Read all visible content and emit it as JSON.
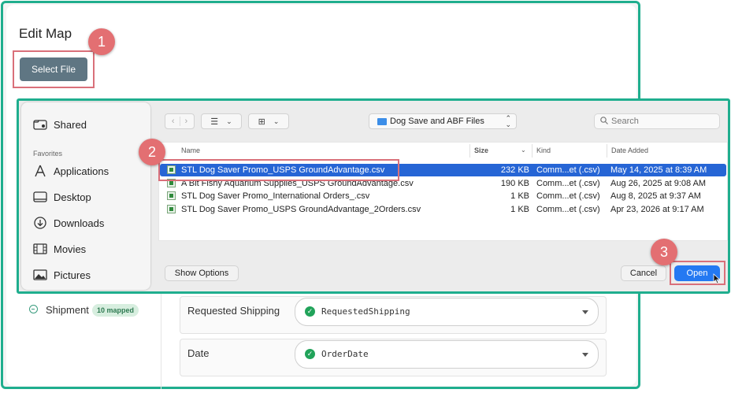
{
  "page": {
    "title": "Edit Map",
    "select_file_label": "Select File"
  },
  "steps": [
    "1",
    "2",
    "3"
  ],
  "shipment": {
    "label": "Shipment",
    "badge": "10 mapped"
  },
  "fields": [
    {
      "label": "Requested Shipping",
      "value": "RequestedShipping"
    },
    {
      "label": "Date",
      "value": "OrderDate"
    }
  ],
  "dialog": {
    "sidebar": {
      "shared": "Shared",
      "favorites_heading": "Favorites",
      "favorites": [
        "Applications",
        "Desktop",
        "Downloads",
        "Movies",
        "Pictures"
      ]
    },
    "location": "Dog Save and ABF Files",
    "search_placeholder": "Search",
    "columns": {
      "name": "Name",
      "size": "Size",
      "kind": "Kind",
      "date": "Date Added"
    },
    "files": [
      {
        "name": "STL Dog Saver Promo_USPS GroundAdvantage.csv",
        "size": "232 KB",
        "kind": "Comm...et (.csv)",
        "date": "May 14, 2025 at 8:39 AM",
        "selected": true
      },
      {
        "name": "A Bit Fishy Aquarium Supplies_USPS GroundAdvantage.csv",
        "size": "190 KB",
        "kind": "Comm...et (.csv)",
        "date": "Aug 26, 2025 at 9:08 AM",
        "selected": false
      },
      {
        "name": "STL Dog Saver Promo_International Orders_.csv",
        "size": "1 KB",
        "kind": "Comm...et (.csv)",
        "date": "Aug 8, 2025 at 9:37 AM",
        "selected": false
      },
      {
        "name": "STL Dog Saver Promo_USPS GroundAdvantage_2Orders.csv",
        "size": "1 KB",
        "kind": "Comm...et (.csv)",
        "date": "Apr 23, 2026 at 9:17 AM",
        "selected": false
      }
    ],
    "show_options": "Show Options",
    "cancel": "Cancel",
    "open": "Open"
  },
  "colors": {
    "accent_teal": "#1fae8e",
    "highlight": "#d9707a",
    "badge": "#e36f72",
    "selection": "#2665d5",
    "open_button": "#2479f2",
    "select_file_button": "#5f7683"
  },
  "icons": {
    "shared": "shared-folder-icon",
    "applications": "applications-icon",
    "desktop": "desktop-icon",
    "downloads": "downloads-icon",
    "movies": "movies-icon",
    "pictures": "pictures-icon"
  }
}
